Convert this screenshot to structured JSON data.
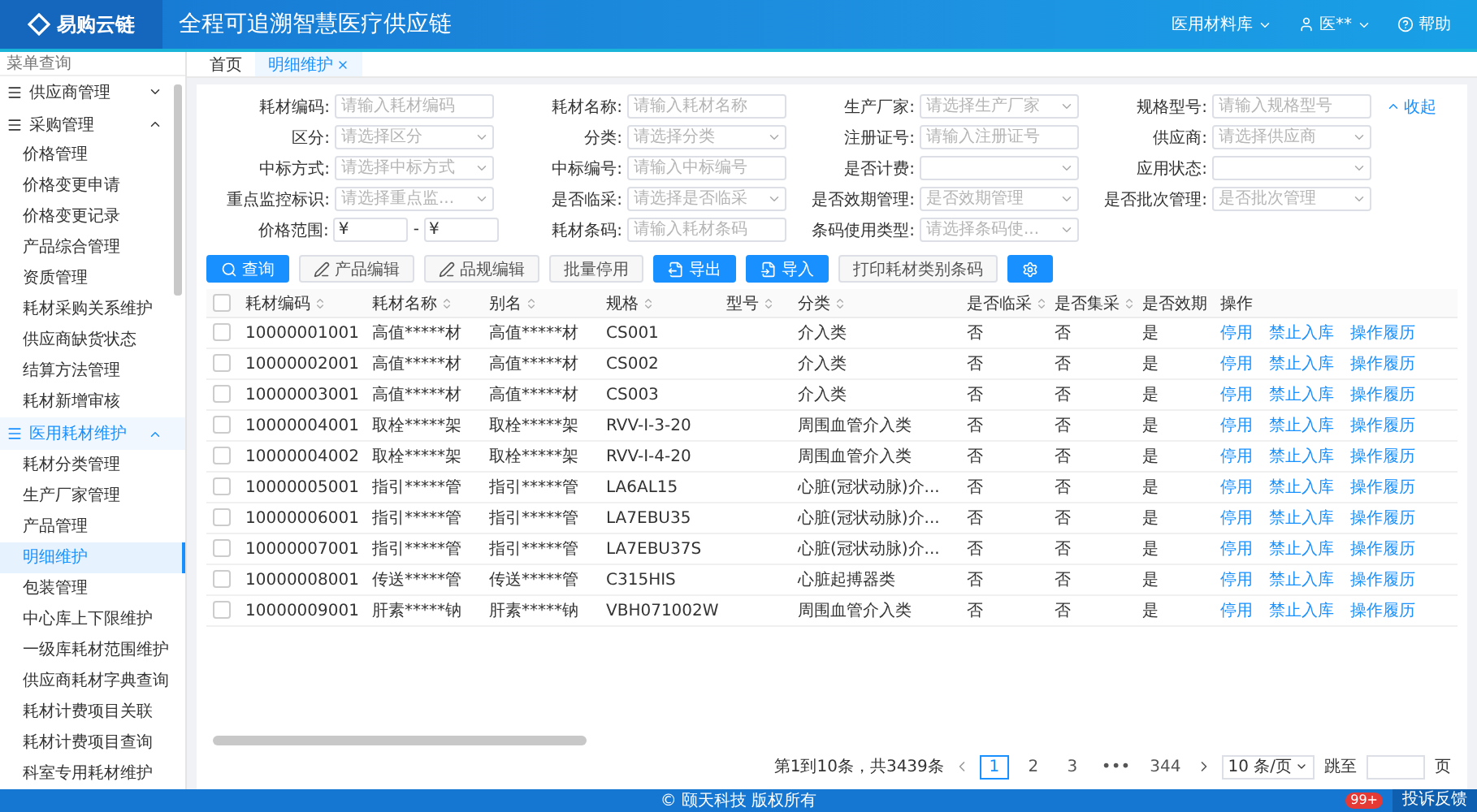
{
  "header": {
    "logo_text": "易购云链",
    "title": "全程可追溯智慧医疗供应链",
    "org": "医用材料库",
    "user": "医**",
    "help": "帮助"
  },
  "sidebar": {
    "search_placeholder": "菜单查询",
    "groups": [
      {
        "label": "供应商管理",
        "expanded": false
      },
      {
        "label": "采购管理",
        "expanded": true,
        "children": [
          {
            "label": "价格管理",
            "selected": false
          },
          {
            "label": "价格变更申请",
            "selected": false
          },
          {
            "label": "价格变更记录",
            "selected": false
          },
          {
            "label": "产品综合管理",
            "selected": false
          },
          {
            "label": "资质管理",
            "selected": false
          },
          {
            "label": "耗材采购关系维护",
            "selected": false
          },
          {
            "label": "供应商缺货状态",
            "selected": false
          },
          {
            "label": "结算方法管理",
            "selected": false
          },
          {
            "label": "耗材新增审核",
            "selected": false
          }
        ]
      },
      {
        "label": "医用耗材维护",
        "expanded": true,
        "children": [
          {
            "label": "耗材分类管理",
            "selected": false
          },
          {
            "label": "生产厂家管理",
            "selected": false
          },
          {
            "label": "产品管理",
            "selected": false
          },
          {
            "label": "明细维护",
            "selected": true
          },
          {
            "label": "包装管理",
            "selected": false
          },
          {
            "label": "中心库上下限维护",
            "selected": false
          },
          {
            "label": "一级库耗材范围维护",
            "selected": false
          },
          {
            "label": "供应商耗材字典查询",
            "selected": false
          },
          {
            "label": "耗材计费项目关联",
            "selected": false
          },
          {
            "label": "耗材计费项目查询",
            "selected": false
          },
          {
            "label": "科室专用耗材维护",
            "selected": false
          }
        ]
      }
    ]
  },
  "tabs": [
    {
      "label": "首页",
      "selected": false,
      "closable": false
    },
    {
      "label": "明细维护",
      "selected": true,
      "closable": true
    }
  ],
  "filters": {
    "collapse_link": "收起",
    "rows": [
      [
        {
          "label": "耗材编码:",
          "kind": "input",
          "placeholder": "请输入耗材编码"
        },
        {
          "label": "耗材名称:",
          "kind": "input",
          "placeholder": "请输入耗材名称"
        },
        {
          "label": "生产厂家:",
          "kind": "select",
          "placeholder": "请选择生产厂家"
        },
        {
          "label": "规格型号:",
          "kind": "input",
          "placeholder": "请输入规格型号"
        }
      ],
      [
        {
          "label": "区分:",
          "kind": "select",
          "placeholder": "请选择区分"
        },
        {
          "label": "分类:",
          "kind": "select",
          "placeholder": "请选择分类"
        },
        {
          "label": "注册证号:",
          "kind": "input",
          "placeholder": "请输入注册证号"
        },
        {
          "label": "供应商:",
          "kind": "select",
          "placeholder": "请选择供应商"
        }
      ],
      [
        {
          "label": "中标方式:",
          "kind": "select",
          "placeholder": "请选择中标方式"
        },
        {
          "label": "中标编号:",
          "kind": "input",
          "placeholder": "请输入中标编号"
        },
        {
          "label": "是否计费:",
          "kind": "select"
        },
        {
          "label": "应用状态:",
          "kind": "select"
        }
      ],
      [
        {
          "label": "重点监控标识:",
          "kind": "select",
          "placeholder": "请选择重点监..."
        },
        {
          "label": "是否临采:",
          "kind": "select",
          "placeholder": "请选择是否临采"
        },
        {
          "label": "是否效期管理:",
          "kind": "select",
          "placeholder": "是否效期管理"
        },
        {
          "label": "是否批次管理:",
          "kind": "select",
          "placeholder": "是否批次管理"
        }
      ],
      [
        {
          "label": "价格范围:",
          "kind": "range",
          "prefix": "¥",
          "separator": "-"
        },
        {
          "label": "耗材条码:",
          "kind": "input",
          "placeholder": "请输入耗材条码"
        },
        {
          "label": "条码使用类型:",
          "kind": "select",
          "placeholder": "请选择条码使..."
        }
      ]
    ]
  },
  "toolbar": [
    {
      "label": "查询",
      "kind": "search",
      "primary": true
    },
    {
      "label": "产品编辑",
      "kind": "edit",
      "primary": false
    },
    {
      "label": "品规编辑",
      "kind": "edit",
      "primary": false
    },
    {
      "label": "批量停用",
      "kind": "plain",
      "primary": false
    },
    {
      "label": "导出",
      "kind": "export",
      "primary": true
    },
    {
      "label": "导入",
      "kind": "import",
      "primary": true
    },
    {
      "label": "打印耗材类别条码",
      "kind": "plain",
      "primary": false
    },
    {
      "kind": "settings",
      "primary": true
    }
  ],
  "table": {
    "all_checked": false,
    "columns": [
      {
        "label": "耗材编码",
        "sortable": true
      },
      {
        "label": "耗材名称",
        "sortable": true
      },
      {
        "label": "别名",
        "sortable": true
      },
      {
        "label": "规格",
        "sortable": true
      },
      {
        "label": "型号",
        "sortable": true
      },
      {
        "label": "分类",
        "sortable": true
      },
      {
        "label": "是否临采",
        "sortable": true
      },
      {
        "label": "是否集采",
        "sortable": true
      },
      {
        "label": "是否效期",
        "sortable": false
      },
      {
        "label": "操作",
        "sortable": false
      }
    ],
    "rows": [
      {
        "checked": false,
        "cells": [
          "10000001001",
          "高值*****材",
          "高值*****材",
          "CS001",
          "",
          "介入类",
          "否",
          "否",
          "是"
        ],
        "actions": [
          "停用",
          "禁止入库",
          "操作履历"
        ]
      },
      {
        "checked": false,
        "cells": [
          "10000002001",
          "高值*****材",
          "高值*****材",
          "CS002",
          "",
          "介入类",
          "否",
          "否",
          "是"
        ],
        "actions": [
          "停用",
          "禁止入库",
          "操作履历"
        ]
      },
      {
        "checked": false,
        "cells": [
          "10000003001",
          "高值*****材",
          "高值*****材",
          "CS003",
          "",
          "介入类",
          "否",
          "否",
          "是"
        ],
        "actions": [
          "停用",
          "禁止入库",
          "操作履历"
        ]
      },
      {
        "checked": false,
        "cells": [
          "10000004001",
          "取栓*****架",
          "取栓*****架",
          "RVV-I-3-20",
          "",
          "周围血管介入类",
          "否",
          "否",
          "是"
        ],
        "actions": [
          "停用",
          "禁止入库",
          "操作履历"
        ]
      },
      {
        "checked": false,
        "cells": [
          "10000004002",
          "取栓*****架",
          "取栓*****架",
          "RVV-I-4-20",
          "",
          "周围血管介入类",
          "否",
          "否",
          "是"
        ],
        "actions": [
          "停用",
          "禁止入库",
          "操作履历"
        ]
      },
      {
        "checked": false,
        "cells": [
          "10000005001",
          "指引*****管",
          "指引*****管",
          "LA6AL15",
          "",
          "心脏(冠状动脉)介...",
          "否",
          "否",
          "是"
        ],
        "actions": [
          "停用",
          "禁止入库",
          "操作履历"
        ]
      },
      {
        "checked": false,
        "cells": [
          "10000006001",
          "指引*****管",
          "指引*****管",
          "LA7EBU35",
          "",
          "心脏(冠状动脉)介...",
          "否",
          "否",
          "是"
        ],
        "actions": [
          "停用",
          "禁止入库",
          "操作履历"
        ]
      },
      {
        "checked": false,
        "cells": [
          "10000007001",
          "指引*****管",
          "指引*****管",
          "LA7EBU37S",
          "",
          "心脏(冠状动脉)介...",
          "否",
          "否",
          "是"
        ],
        "actions": [
          "停用",
          "禁止入库",
          "操作履历"
        ]
      },
      {
        "checked": false,
        "cells": [
          "10000008001",
          "传送*****管",
          "传送*****管",
          "C315HIS",
          "",
          "心脏起搏器类",
          "否",
          "否",
          "是"
        ],
        "actions": [
          "停用",
          "禁止入库",
          "操作履历"
        ]
      },
      {
        "checked": false,
        "cells": [
          "10000009001",
          "肝素*****钠",
          "肝素*****钠",
          "VBH071002W",
          "",
          "周围血管介入类",
          "否",
          "否",
          "是"
        ],
        "actions": [
          "停用",
          "禁止入库",
          "操作履历"
        ]
      }
    ]
  },
  "pagination": {
    "summary": "第1到10条，共3439条",
    "pages": [
      {
        "label": "1",
        "selected": true
      },
      {
        "label": "2",
        "selected": false
      },
      {
        "label": "3",
        "selected": false
      },
      {
        "label": "•••",
        "selected": false
      },
      {
        "label": "344",
        "selected": false
      }
    ],
    "page_size": "10 条/页",
    "jump_label": "跳至",
    "jump_suffix": "页"
  },
  "footer": {
    "copyright": "© 颐天科技 版权所有",
    "feedback": "投诉反馈",
    "badge": "99+"
  }
}
